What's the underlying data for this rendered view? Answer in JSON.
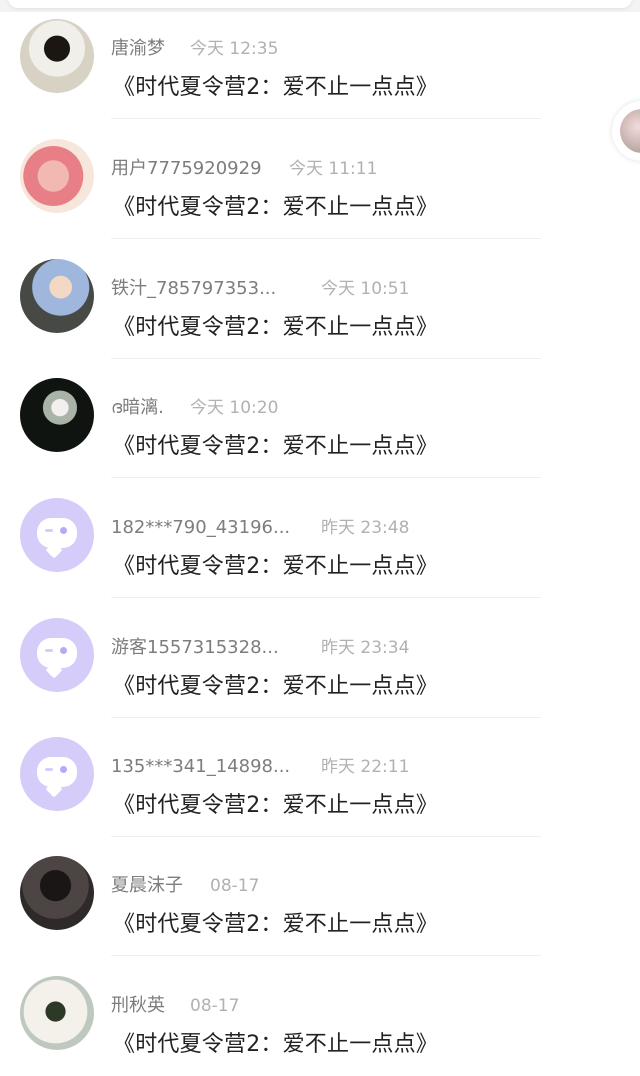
{
  "conversations": [
    {
      "name": "唐渝梦",
      "time": "今天 12:35",
      "message": "《时代夏令营2：爱不止一点点》",
      "avatar": "photo"
    },
    {
      "name": "用户7775920929",
      "time": "今天 11:11",
      "message": "《时代夏令营2：爱不止一点点》",
      "avatar": "photo"
    },
    {
      "name": "铁汁_785797353...",
      "time": "今天 10:51",
      "message": "《时代夏令营2：爱不止一点点》",
      "avatar": "photo"
    },
    {
      "name": "ദ暗漓.",
      "time": "今天 10:20",
      "message": "《时代夏令营2：爱不止一点点》",
      "avatar": "photo"
    },
    {
      "name": "182***790_43196...",
      "time": "昨天 23:48",
      "message": "《时代夏令营2：爱不止一点点》",
      "avatar": "default-chat-icon"
    },
    {
      "name": "游客1557315328...",
      "time": "昨天 23:34",
      "message": "《时代夏令营2：爱不止一点点》",
      "avatar": "default-chat-icon"
    },
    {
      "name": "135***341_14898...",
      "time": "昨天 22:11",
      "message": "《时代夏令营2：爱不止一点点》",
      "avatar": "default-chat-icon"
    },
    {
      "name": "夏晨沫子",
      "time": "08-17",
      "message": "《时代夏令营2：爱不止一点点》",
      "avatar": "photo"
    },
    {
      "name": "刑秋英",
      "time": "08-17",
      "message": "《时代夏令营2：爱不止一点点》",
      "avatar": "photo"
    }
  ],
  "colors": {
    "default_avatar_bg": "#d6ccfa",
    "name_text": "#7d7d7d",
    "time_text": "#b1b1b1",
    "message_text": "#222222"
  }
}
